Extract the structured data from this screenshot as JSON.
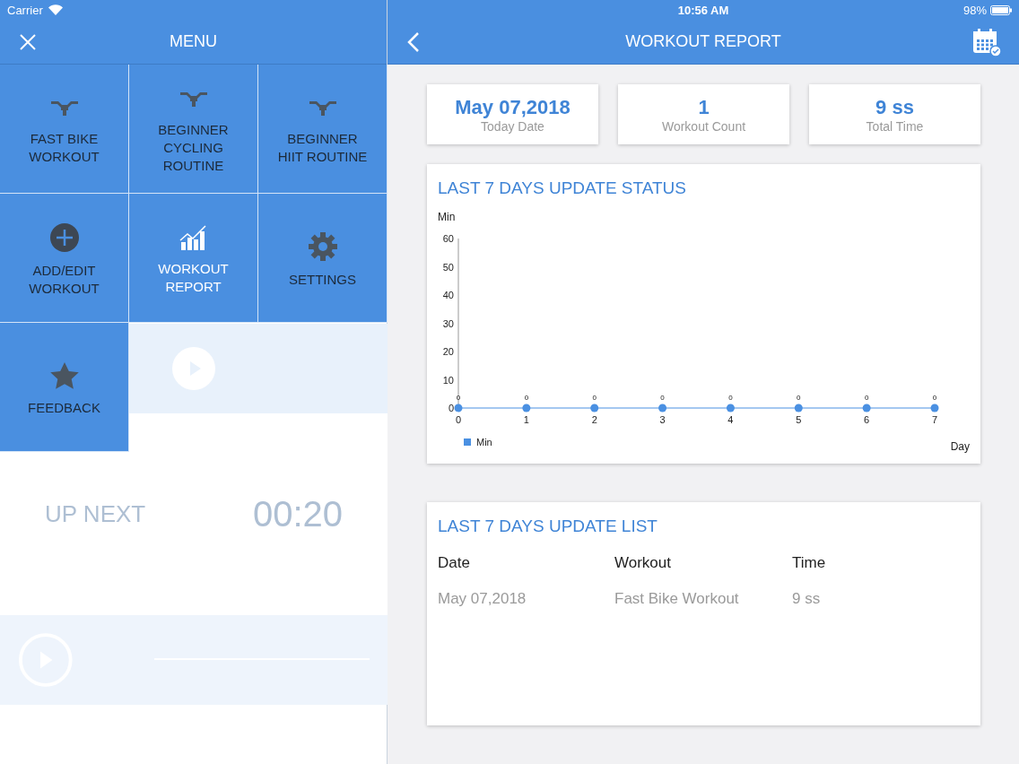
{
  "status_bar": {
    "carrier": "Carrier",
    "time": "10:56 AM",
    "battery": "98%"
  },
  "menu": {
    "title": "MENU",
    "items": [
      {
        "label": "FAST BIKE WORKOUT",
        "kind": "bike",
        "selected": false
      },
      {
        "label": "BEGINNER CYCLING ROUTINE",
        "kind": "bike",
        "selected": false
      },
      {
        "label": "BEGINNER HIIT ROUTINE",
        "kind": "bike",
        "selected": false
      },
      {
        "label": "ADD/EDIT WORKOUT",
        "kind": "add",
        "selected": false
      },
      {
        "label": "WORKOUT REPORT",
        "kind": "report",
        "selected": true
      },
      {
        "label": "SETTINGS",
        "kind": "settings",
        "selected": false
      },
      {
        "label": "FEEDBACK",
        "kind": "feedback",
        "selected": false
      }
    ]
  },
  "background_screen": {
    "up_next": "UP NEXT",
    "next_time": "00:20"
  },
  "report": {
    "title": "WORKOUT REPORT",
    "stats": [
      {
        "value": "May 07,2018",
        "label": "Today Date"
      },
      {
        "value": "1",
        "label": "Workout Count"
      },
      {
        "value": "9 ss",
        "label": "Total Time"
      }
    ],
    "status_card": {
      "title": "LAST 7 DAYS UPDATE STATUS",
      "chart_data": {
        "type": "line",
        "xlabel": "Day",
        "ylabel": "Min",
        "x": [
          0,
          1,
          2,
          3,
          4,
          5,
          6,
          7
        ],
        "series": [
          {
            "name": "Min",
            "color": "#4a90e2",
            "marker": "circle",
            "values": [
              0,
              0,
              0,
              0,
              0,
              0,
              0,
              0
            ]
          }
        ],
        "xlim": [
          0,
          7
        ],
        "ylim": [
          0,
          60
        ],
        "xticks": [
          0,
          1,
          2,
          3,
          4,
          5,
          6,
          7
        ],
        "yticks": [
          0,
          10,
          20,
          30,
          40,
          50,
          60
        ],
        "data_labels": true
      }
    },
    "list_card": {
      "title": "LAST 7 DAYS UPDATE LIST",
      "columns": [
        "Date",
        "Workout",
        "Time"
      ],
      "rows": [
        [
          "May 07,2018",
          "Fast Bike Workout",
          "9 ss"
        ]
      ]
    }
  }
}
